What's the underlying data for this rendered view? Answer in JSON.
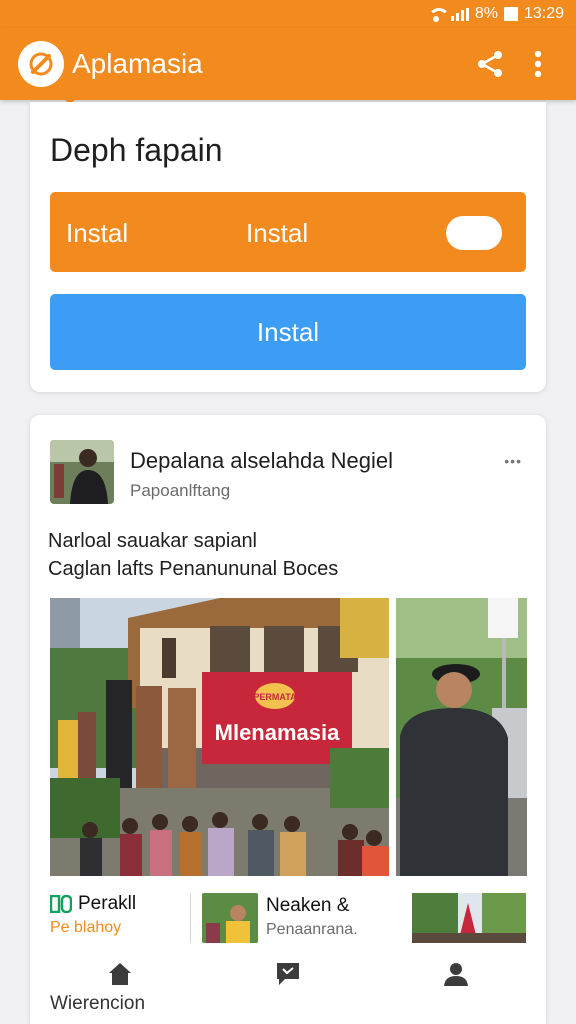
{
  "status_bar": {
    "battery_text": "8%",
    "time": "13:29"
  },
  "app_bar": {
    "title": "Aplamasia",
    "logo_icon": "app-logo-icon",
    "actions": [
      "share-icon",
      "more-vert-icon"
    ]
  },
  "install_card": {
    "title": "Deph fapain",
    "orange_button": {
      "label_1": "Instal",
      "label_2": "Instal"
    },
    "blue_button": {
      "label": "Instal"
    }
  },
  "post": {
    "title": "Depalana alselahda Negiel",
    "subtitle": "Papoanlftang",
    "more": "•••",
    "text_line_1": "Narloal sauakar sapianl",
    "text_line_2": "Caglan lafts Penanununal  Boces",
    "banner_text": "Mlenamasia",
    "banner_badge": "PERMATA"
  },
  "strip": {
    "item1_title": "Perakll",
    "item1_sub": "Pe blahoy",
    "item2_title": "Neaken &",
    "item2_sub": "Penaanrana."
  },
  "bottom_nav": {
    "items": [
      "home-icon",
      "chat-icon",
      "person-icon"
    ],
    "label": "Wierencion"
  },
  "colors": {
    "accent": "#f28a1e",
    "primary_blue": "#3d9cf3",
    "background": "#f0f0f2"
  }
}
